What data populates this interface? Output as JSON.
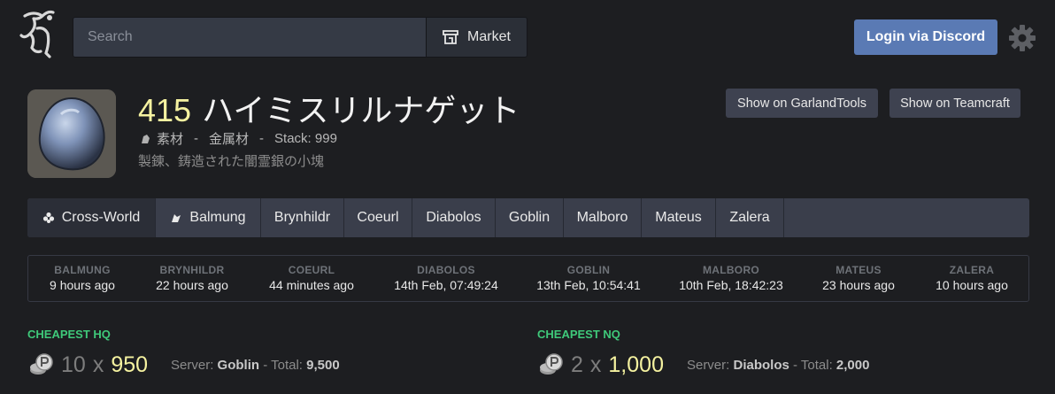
{
  "header": {
    "search_placeholder": "Search",
    "market_label": "Market",
    "login_label": "Login via Discord"
  },
  "item": {
    "level": "415",
    "name": "ハイミスリルナゲット",
    "category": "素材",
    "subcategory": "金属材",
    "stack": "Stack: 999",
    "description": "製錬、鋳造された闇霊銀の小塊",
    "garland_label": "Show on GarlandTools",
    "teamcraft_label": "Show on Teamcraft"
  },
  "tabs": [
    {
      "label": "Cross-World"
    },
    {
      "label": "Balmung"
    },
    {
      "label": "Brynhildr"
    },
    {
      "label": "Coeurl"
    },
    {
      "label": "Diabolos"
    },
    {
      "label": "Goblin"
    },
    {
      "label": "Malboro"
    },
    {
      "label": "Mateus"
    },
    {
      "label": "Zalera"
    }
  ],
  "updates": [
    {
      "world": "BALMUNG",
      "time": "9 hours ago"
    },
    {
      "world": "BRYNHILDR",
      "time": "22 hours ago"
    },
    {
      "world": "COEURL",
      "time": "44 minutes ago"
    },
    {
      "world": "DIABOLOS",
      "time": "14th Feb, 07:49:24"
    },
    {
      "world": "GOBLIN",
      "time": "13th Feb, 10:54:41"
    },
    {
      "world": "MALBORO",
      "time": "10th Feb, 18:42:23"
    },
    {
      "world": "MATEUS",
      "time": "23 hours ago"
    },
    {
      "world": "ZALERA",
      "time": "10 hours ago"
    }
  ],
  "cheapest_hq": {
    "label": "CHEAPEST HQ",
    "qty": "10",
    "x": "x",
    "price": "950",
    "server_prefix": "Server: ",
    "server": "Goblin",
    "total_prefix": " - Total: ",
    "total": "9,500"
  },
  "cheapest_nq": {
    "label": "CHEAPEST NQ",
    "qty": "2",
    "x": "x",
    "price": "1,000",
    "server_prefix": "Server: ",
    "server": "Diabolos",
    "total_prefix": " - Total: ",
    "total": "2,000"
  },
  "colors": {
    "accent_green": "#3fc97a",
    "price_yellow": "#f5f2a0",
    "login_blue": "#5a7ab4"
  }
}
